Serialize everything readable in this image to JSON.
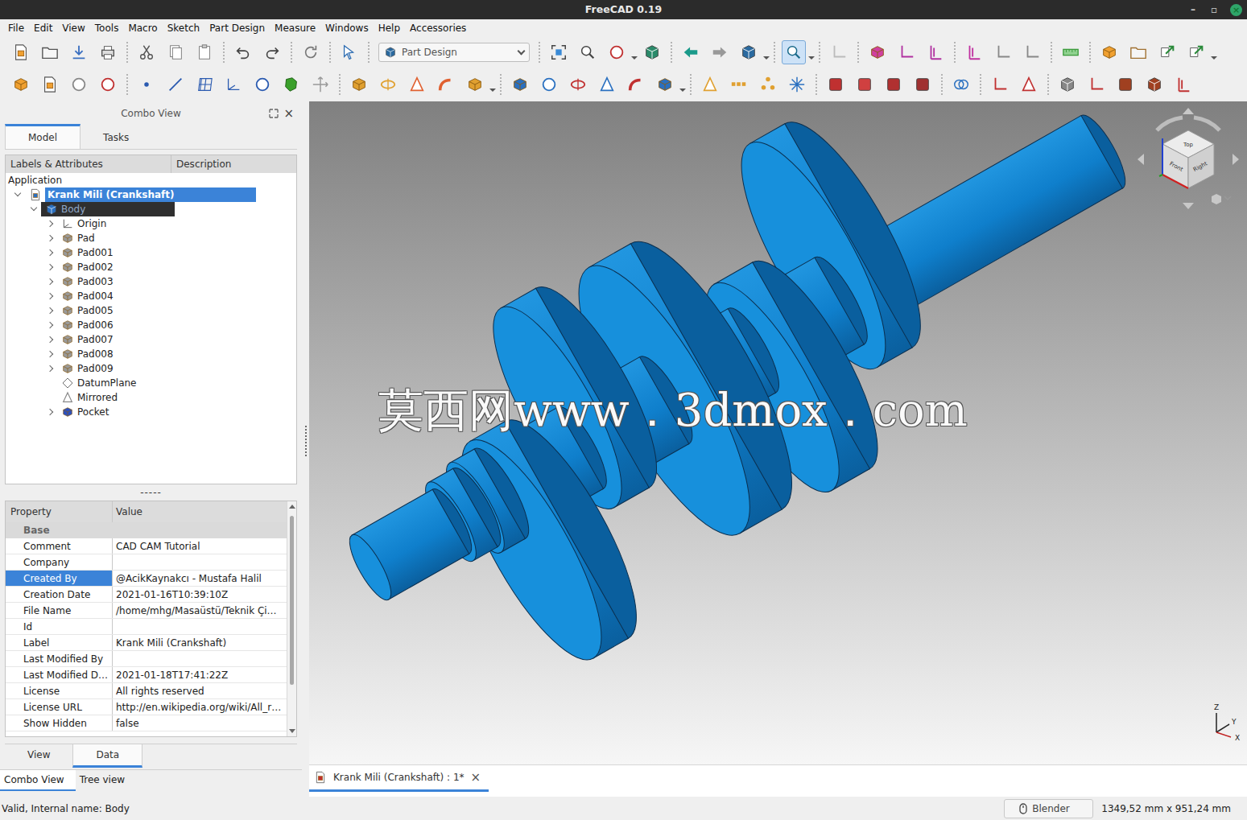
{
  "window": {
    "title": "FreeCAD 0.19",
    "controls": [
      "–",
      "▫",
      "×"
    ]
  },
  "menu": [
    "File",
    "Edit",
    "View",
    "Tools",
    "Macro",
    "Sketch",
    "Part Design",
    "Measure",
    "Windows",
    "Help",
    "Accessories"
  ],
  "toolbar": {
    "workbench": {
      "label": "Part Design"
    },
    "selection_view": {
      "checked": true
    }
  },
  "combo_view": {
    "title": "Combo View",
    "close": "×",
    "tabs": [
      {
        "label": "Model",
        "selected": true
      },
      {
        "label": "Tasks",
        "selected": false
      }
    ]
  },
  "tree": {
    "columns": [
      "Labels & Attributes",
      "Description"
    ],
    "root": "Application",
    "document": {
      "label": "Krank Mili (Crankshaft)",
      "expanded": true,
      "selected": true,
      "body": {
        "label": "Body",
        "expanded": true,
        "active": true,
        "children": [
          {
            "label": "Origin",
            "kind": "origin",
            "expandable": true
          },
          {
            "label": "Pad",
            "kind": "pad",
            "expandable": true
          },
          {
            "label": "Pad001",
            "kind": "pad",
            "expandable": true
          },
          {
            "label": "Pad002",
            "kind": "pad",
            "expandable": true
          },
          {
            "label": "Pad003",
            "kind": "pad",
            "expandable": true
          },
          {
            "label": "Pad004",
            "kind": "pad",
            "expandable": true
          },
          {
            "label": "Pad005",
            "kind": "pad",
            "expandable": true
          },
          {
            "label": "Pad006",
            "kind": "pad",
            "expandable": true
          },
          {
            "label": "Pad007",
            "kind": "pad",
            "expandable": true
          },
          {
            "label": "Pad008",
            "kind": "pad",
            "expandable": true
          },
          {
            "label": "Pad009",
            "kind": "pad",
            "expandable": true
          },
          {
            "label": "DatumPlane",
            "kind": "datum",
            "expandable": false
          },
          {
            "label": "Mirrored",
            "kind": "mirrored",
            "expandable": false
          },
          {
            "label": "Pocket",
            "kind": "pocket",
            "expandable": true
          }
        ]
      }
    }
  },
  "splitter": "-----",
  "properties": {
    "columns": [
      "Property",
      "Value"
    ],
    "group": "Base",
    "rows": [
      {
        "name": "Comment",
        "value": "CAD CAM Tutorial",
        "selected": false
      },
      {
        "name": "Company",
        "value": "",
        "selected": false
      },
      {
        "name": "Created By",
        "value": "@AcikKaynakcı - Mustafa Halil",
        "selected": true
      },
      {
        "name": "Creation Date",
        "value": "2021-01-16T10:39:10Z",
        "selected": false
      },
      {
        "name": "File Name",
        "value": "/home/mhg/Masaüstü/Teknik Çi…",
        "selected": false
      },
      {
        "name": "Id",
        "value": "",
        "selected": false
      },
      {
        "name": "Label",
        "value": "Krank Mili (Crankshaft)",
        "selected": false
      },
      {
        "name": "Last Modified By",
        "value": "",
        "selected": false
      },
      {
        "name": "Last Modified D…",
        "value": "2021-01-18T17:41:22Z",
        "selected": false
      },
      {
        "name": "License",
        "value": "All rights reserved",
        "selected": false
      },
      {
        "name": "License URL",
        "value": "http://en.wikipedia.org/wiki/All_r…",
        "selected": false
      },
      {
        "name": "Show Hidden",
        "value": "false",
        "selected": false
      }
    ]
  },
  "property_tabs": [
    {
      "label": "View",
      "selected": false
    },
    {
      "label": "Data",
      "selected": true
    }
  ],
  "dock_tabs": [
    {
      "label": "Combo View",
      "selected": true
    },
    {
      "label": "Tree view",
      "selected": false
    }
  ],
  "viewport": {
    "watermark": "莫西网www．3dmox．com",
    "nav_cube": [
      "Top",
      "Front",
      "Right"
    ],
    "axes": [
      "Z",
      "Y",
      "X"
    ]
  },
  "document_tabs": [
    {
      "label": "Krank Mili (Crankshaft) : 1*",
      "close": "×",
      "selected": true
    }
  ],
  "status_bar": {
    "message": "Valid, Internal name: Body",
    "navigation": "Blender",
    "dimensions": "1349,52 mm x 951,24 mm"
  }
}
